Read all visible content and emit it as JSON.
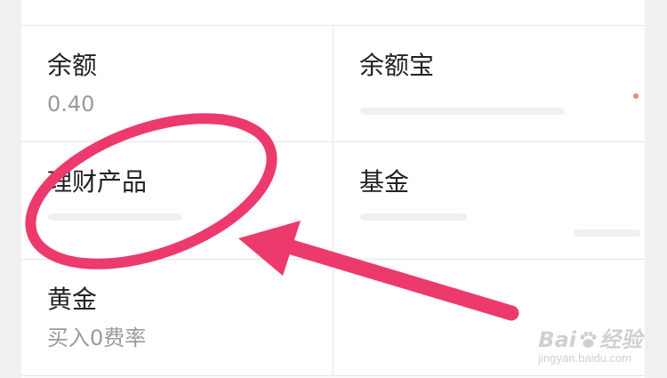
{
  "grid": {
    "cells": [
      {
        "title": "余额",
        "subtitle": "0.40"
      },
      {
        "title": "余额宝",
        "subtitle": ""
      },
      {
        "title": "理财产品",
        "subtitle": ""
      },
      {
        "title": "基金",
        "subtitle": ""
      },
      {
        "title": "黄金",
        "subtitle": "买入0费率"
      }
    ]
  },
  "annotation": {
    "color": "#ec3a6d",
    "shapes": [
      "ellipse-circle",
      "arrow"
    ]
  },
  "watermark": {
    "brand": "Bai",
    "brand_suffix": "经验",
    "url": "jingyan.baidu.com"
  },
  "icons": [
    "baidu-paw-icon"
  ]
}
